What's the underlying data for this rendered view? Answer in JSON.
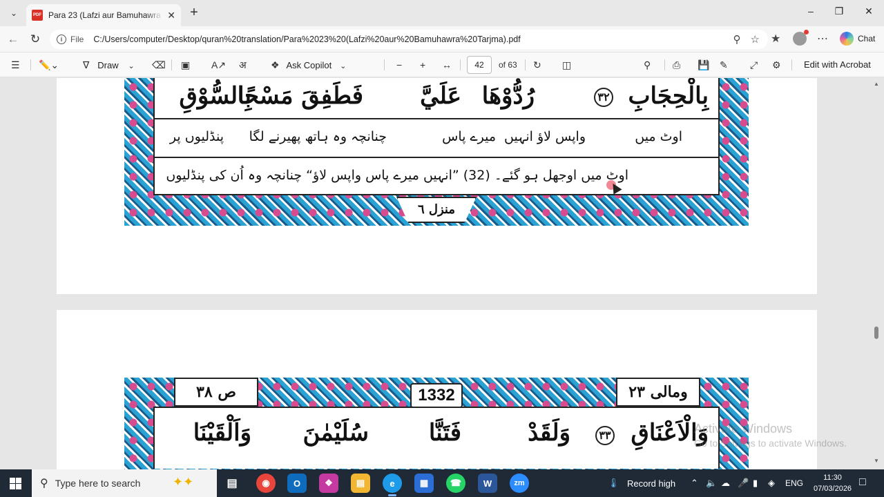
{
  "browser": {
    "tab_title": "Para 23 (Lafzi aur Bamuhawra Tarjma).pdf",
    "url_prefix": "File",
    "url": "C:/Users/computer/Desktop/quran%20translation/Para%2023%20(Lafzi%20aur%20Bamuhawra%20Tarjma).pdf",
    "chat_label": "Chat"
  },
  "pdf_toolbar": {
    "draw_label": "Draw",
    "ask_copilot_label": "Ask Copilot",
    "page_number": "42",
    "page_total": "of 63",
    "edit_label": "Edit with Acrobat"
  },
  "page1": {
    "arabic_words": [
      "بِالْحِجَابِ",
      "٣٢",
      "رُدُّوْهَا",
      "عَلَيَّ",
      "فَطَفِقَ مَسْحًا",
      "بِالسُّوْقِ"
    ],
    "word_translations": [
      "اوٹ میں",
      "واپس لاؤ انہیں",
      "میرے پاس",
      "چنانچہ وہ ہاتھ پھیرنے لگا",
      "پنڈلیوں پر"
    ],
    "full_translation": "اوٹ میں اوجھل ہو گئے۔ (32) ”انہیں میرے پاس واپس لاؤ“ چنانچہ وہ اُن کی پنڈلیوں",
    "manzil": "منزل ٦"
  },
  "page2": {
    "left_label": "ص ٣٨",
    "page_number": "1332",
    "right_label": "ومالی ٢٣",
    "arabic_words": [
      "وَالْاَعْنَاقِ",
      "٣٣",
      "وَلَقَدْ",
      "فَتَنَّا",
      "سُلَيْمٰنَ",
      "وَاَلْقَيْنَا"
    ]
  },
  "watermark": {
    "line1": "Activate Windows",
    "line2": "Go to Settings to activate Windows."
  },
  "taskbar": {
    "search_placeholder": "Type here to search",
    "record_label": "Record high",
    "language": "ENG",
    "time": "11:30",
    "date": "07/03/2026"
  }
}
